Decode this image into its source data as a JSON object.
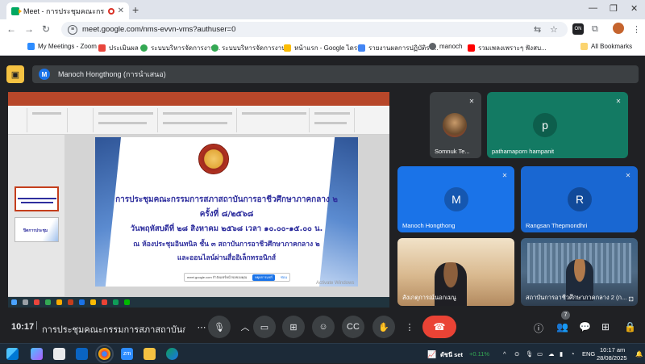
{
  "browser": {
    "tab_title": "Meet - การประชุมคณะกรรมการ",
    "tab_close": "✕",
    "new_tab": "+",
    "url": "meet.google.com/nms-evvn-vms?authuser=0",
    "bookmarks": [
      {
        "label": "My Meetings - Zoom",
        "color": "#2d8cff"
      },
      {
        "label": "ประเมินผล",
        "color": "#e8453c"
      },
      {
        "label": "ระบบบริหารจัดการงาน...",
        "color": "#34a853"
      },
      {
        "label": "ระบบบริหารจัดการงาน...",
        "color": "#34a853"
      },
      {
        "label": "หน้าแรก - Google ไดรฟ์",
        "color": "#fbbc04"
      },
      {
        "label": "รายงานผลการปฏิบัติรา...",
        "color": "#4285f4"
      },
      {
        "label": "manoch",
        "color": "#5f6368"
      },
      {
        "label": "รวมเพลงเพราะๆ ฟังสบ...",
        "color": "#ff0000"
      }
    ],
    "all_bookmarks": "All Bookmarks"
  },
  "meet": {
    "presenter_label": "Manoch Hongthong (การนำเสนอ)",
    "presenter_initial": "M",
    "slide": {
      "line1": "การประชุมคณะกรรมการสภาสถาบันการอาชีวศึกษาภาคกลาง ๒",
      "line2": "ครั้งที่ ๘/๒๕๖๘",
      "line3": "วันพฤหัสบดีที่ ๒๘ สิงหาคม ๒๕๖๘ เวลา ๑๐.๐๐-๑๕.๐๐ น.",
      "line4": "ณ ห้องประชุมอินทนิล ชั้น ๓ สถาบันการอาชีวศึกษาภาคกลาง ๒",
      "line5": "และออนไลน์ผ่านสื่ออิเล็กทรอนิกส์",
      "share_text": "meet.google.com กำลังแชร์หน้าจอของคุณ",
      "share_stop": "หยุดการแชร์",
      "share_hide": "ซ่อน",
      "watermark": "Activate Windows",
      "thumb2_text": "ปิดการประชุม"
    },
    "participants": [
      {
        "name": "Somnuk Te...",
        "initial": "",
        "color": "#3c4043"
      },
      {
        "name": "pathamaporn hampanit",
        "initial": "p",
        "color": "#137a63"
      },
      {
        "name": "Manoch Hongthong",
        "initial": "M",
        "color": "#1a73e8"
      },
      {
        "name": "Rangsan Thepmondhri",
        "initial": "R",
        "color": "#1967d2"
      },
      {
        "name": "สังเกตุการณ์นอกเมนู",
        "initial": "",
        "color": "#8a7a6a"
      },
      {
        "name": "สถาบันการอาชีวศึกษาภาคกลาง 2 (ก...",
        "initial": "",
        "color": "#4f6b86"
      }
    ],
    "clock": "10:17",
    "meeting_title": "การประชุมคณะกรรมการสภาสถาบันการอาชีว...",
    "participant_count": "7"
  },
  "taskbar": {
    "stock_name": "ดัชนี set",
    "stock_change": "+0.11%",
    "lang": "ENG",
    "time": "10:17 am",
    "date": "28/08/2025"
  }
}
